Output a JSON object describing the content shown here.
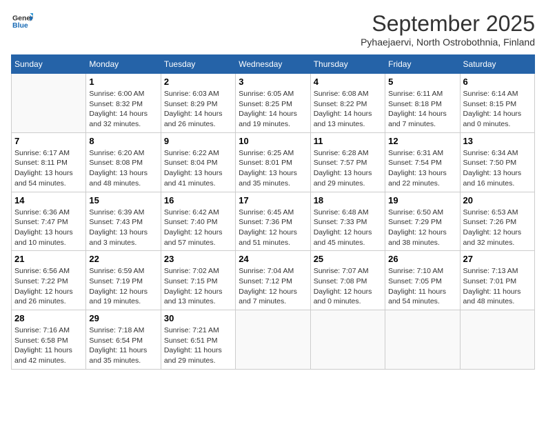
{
  "header": {
    "logo_line1": "General",
    "logo_line2": "Blue",
    "month_title": "September 2025",
    "subtitle": "Pyhaejaervi, North Ostrobothnia, Finland"
  },
  "weekdays": [
    "Sunday",
    "Monday",
    "Tuesday",
    "Wednesday",
    "Thursday",
    "Friday",
    "Saturday"
  ],
  "weeks": [
    [
      {
        "day": "",
        "info": ""
      },
      {
        "day": "1",
        "info": "Sunrise: 6:00 AM\nSunset: 8:32 PM\nDaylight: 14 hours\nand 32 minutes."
      },
      {
        "day": "2",
        "info": "Sunrise: 6:03 AM\nSunset: 8:29 PM\nDaylight: 14 hours\nand 26 minutes."
      },
      {
        "day": "3",
        "info": "Sunrise: 6:05 AM\nSunset: 8:25 PM\nDaylight: 14 hours\nand 19 minutes."
      },
      {
        "day": "4",
        "info": "Sunrise: 6:08 AM\nSunset: 8:22 PM\nDaylight: 14 hours\nand 13 minutes."
      },
      {
        "day": "5",
        "info": "Sunrise: 6:11 AM\nSunset: 8:18 PM\nDaylight: 14 hours\nand 7 minutes."
      },
      {
        "day": "6",
        "info": "Sunrise: 6:14 AM\nSunset: 8:15 PM\nDaylight: 14 hours\nand 0 minutes."
      }
    ],
    [
      {
        "day": "7",
        "info": "Sunrise: 6:17 AM\nSunset: 8:11 PM\nDaylight: 13 hours\nand 54 minutes."
      },
      {
        "day": "8",
        "info": "Sunrise: 6:20 AM\nSunset: 8:08 PM\nDaylight: 13 hours\nand 48 minutes."
      },
      {
        "day": "9",
        "info": "Sunrise: 6:22 AM\nSunset: 8:04 PM\nDaylight: 13 hours\nand 41 minutes."
      },
      {
        "day": "10",
        "info": "Sunrise: 6:25 AM\nSunset: 8:01 PM\nDaylight: 13 hours\nand 35 minutes."
      },
      {
        "day": "11",
        "info": "Sunrise: 6:28 AM\nSunset: 7:57 PM\nDaylight: 13 hours\nand 29 minutes."
      },
      {
        "day": "12",
        "info": "Sunrise: 6:31 AM\nSunset: 7:54 PM\nDaylight: 13 hours\nand 22 minutes."
      },
      {
        "day": "13",
        "info": "Sunrise: 6:34 AM\nSunset: 7:50 PM\nDaylight: 13 hours\nand 16 minutes."
      }
    ],
    [
      {
        "day": "14",
        "info": "Sunrise: 6:36 AM\nSunset: 7:47 PM\nDaylight: 13 hours\nand 10 minutes."
      },
      {
        "day": "15",
        "info": "Sunrise: 6:39 AM\nSunset: 7:43 PM\nDaylight: 13 hours\nand 3 minutes."
      },
      {
        "day": "16",
        "info": "Sunrise: 6:42 AM\nSunset: 7:40 PM\nDaylight: 12 hours\nand 57 minutes."
      },
      {
        "day": "17",
        "info": "Sunrise: 6:45 AM\nSunset: 7:36 PM\nDaylight: 12 hours\nand 51 minutes."
      },
      {
        "day": "18",
        "info": "Sunrise: 6:48 AM\nSunset: 7:33 PM\nDaylight: 12 hours\nand 45 minutes."
      },
      {
        "day": "19",
        "info": "Sunrise: 6:50 AM\nSunset: 7:29 PM\nDaylight: 12 hours\nand 38 minutes."
      },
      {
        "day": "20",
        "info": "Sunrise: 6:53 AM\nSunset: 7:26 PM\nDaylight: 12 hours\nand 32 minutes."
      }
    ],
    [
      {
        "day": "21",
        "info": "Sunrise: 6:56 AM\nSunset: 7:22 PM\nDaylight: 12 hours\nand 26 minutes."
      },
      {
        "day": "22",
        "info": "Sunrise: 6:59 AM\nSunset: 7:19 PM\nDaylight: 12 hours\nand 19 minutes."
      },
      {
        "day": "23",
        "info": "Sunrise: 7:02 AM\nSunset: 7:15 PM\nDaylight: 12 hours\nand 13 minutes."
      },
      {
        "day": "24",
        "info": "Sunrise: 7:04 AM\nSunset: 7:12 PM\nDaylight: 12 hours\nand 7 minutes."
      },
      {
        "day": "25",
        "info": "Sunrise: 7:07 AM\nSunset: 7:08 PM\nDaylight: 12 hours\nand 0 minutes."
      },
      {
        "day": "26",
        "info": "Sunrise: 7:10 AM\nSunset: 7:05 PM\nDaylight: 11 hours\nand 54 minutes."
      },
      {
        "day": "27",
        "info": "Sunrise: 7:13 AM\nSunset: 7:01 PM\nDaylight: 11 hours\nand 48 minutes."
      }
    ],
    [
      {
        "day": "28",
        "info": "Sunrise: 7:16 AM\nSunset: 6:58 PM\nDaylight: 11 hours\nand 42 minutes."
      },
      {
        "day": "29",
        "info": "Sunrise: 7:18 AM\nSunset: 6:54 PM\nDaylight: 11 hours\nand 35 minutes."
      },
      {
        "day": "30",
        "info": "Sunrise: 7:21 AM\nSunset: 6:51 PM\nDaylight: 11 hours\nand 29 minutes."
      },
      {
        "day": "",
        "info": ""
      },
      {
        "day": "",
        "info": ""
      },
      {
        "day": "",
        "info": ""
      },
      {
        "day": "",
        "info": ""
      }
    ]
  ]
}
